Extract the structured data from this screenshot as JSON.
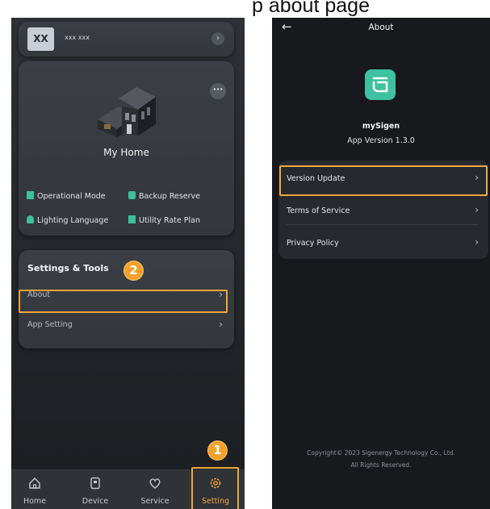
{
  "caption": "p about page",
  "left": {
    "profile": {
      "avatar": "XX",
      "name": "xxx xxx"
    },
    "home": {
      "title": "My Home",
      "features": [
        {
          "label": "Operational Mode",
          "icon": "operational-mode-icon",
          "color": "#3fbf9e"
        },
        {
          "label": "Backup Reserve",
          "icon": "backup-reserve-icon",
          "color": "#3fbf9e"
        },
        {
          "label": "Lighting Language",
          "icon": "lighting-icon",
          "color": "#3fbf9e"
        },
        {
          "label": "Utility Rate Plan",
          "icon": "utility-rate-icon",
          "color": "#3fbf9e"
        }
      ]
    },
    "settings": {
      "title": "Settings & Tools",
      "items": [
        {
          "label": "About"
        },
        {
          "label": "App Setting"
        }
      ]
    },
    "nav": [
      {
        "label": "Home",
        "icon": "home-icon"
      },
      {
        "label": "Device",
        "icon": "device-icon"
      },
      {
        "label": "Service",
        "icon": "service-icon"
      },
      {
        "label": "Setting",
        "icon": "gear-icon",
        "active": true
      }
    ],
    "badges": [
      "2",
      "1"
    ]
  },
  "right": {
    "title": "About",
    "app_name": "mySigen",
    "app_version": "App Version 1.3.0",
    "items": [
      {
        "label": "Version Update"
      },
      {
        "label": "Terms of Service"
      },
      {
        "label": "Privacy Policy"
      }
    ],
    "copyright_line1": "Copyright© 2023 Sigenergy Technology Co., Ltd.",
    "copyright_line2": "All Rights Reserved."
  },
  "colors": {
    "highlight": "#efa53a",
    "accent": "#f1a437",
    "brand": "#3ec1a1"
  }
}
